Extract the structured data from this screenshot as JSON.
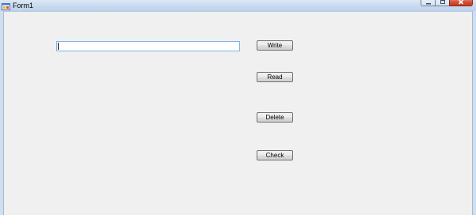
{
  "window": {
    "title": "Form1",
    "icon": "winforms-app-icon"
  },
  "caption_buttons": {
    "minimize_icon": "minimize-icon",
    "maximize_icon": "maximize-icon",
    "close_icon": "close-icon"
  },
  "form": {
    "textbox_value": "",
    "buttons": {
      "write": "Write",
      "read": "Read",
      "delete": "Delete",
      "check": "Check"
    }
  },
  "colors": {
    "titlebar": "#c6d9ee",
    "client_background": "#f0f0f0",
    "close_button": "#c53a20",
    "textbox_focus_border": "#7eb4ea"
  }
}
